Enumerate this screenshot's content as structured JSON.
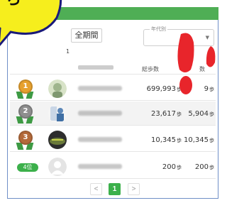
{
  "filters": {
    "period_label": "全期間",
    "era_label": "年代別",
    "page_indicator": "1"
  },
  "columns": {
    "total": "総歩数",
    "average": "数"
  },
  "rows": [
    {
      "rank": "1",
      "total": "699,993",
      "unit": "歩",
      "average": "9",
      "average_unit": "歩",
      "rank_color": "#e7a12e"
    },
    {
      "rank": "2",
      "total": "23,617",
      "unit": "歩",
      "average": "5,904",
      "average_unit": "歩",
      "rank_color": "#8e8e8e"
    },
    {
      "rank": "3",
      "total": "10,345",
      "unit": "歩",
      "average": "10,345",
      "average_unit": "歩",
      "rank_color": "#b46a3a"
    },
    {
      "rank": "4位",
      "total": "200",
      "unit": "歩",
      "average": "200",
      "average_unit": "歩",
      "rank_color": "#3cb04b"
    }
  ],
  "pagination": {
    "prev": "<",
    "current": "1",
    "next": ">"
  },
  "bubble_text": "ら",
  "colors": {
    "accent": "#3cb04b",
    "header": "#4fae55",
    "footprint": "#e8252b",
    "bubble": "#f6ee1d"
  }
}
